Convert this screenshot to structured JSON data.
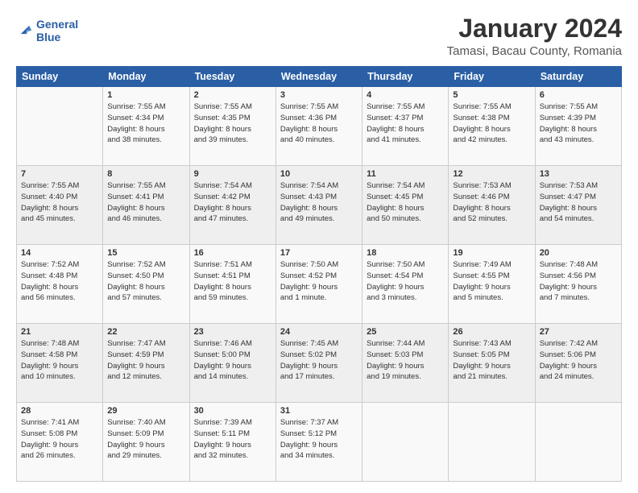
{
  "logo": {
    "line1": "General",
    "line2": "Blue"
  },
  "title": "January 2024",
  "subtitle": "Tamasi, Bacau County, Romania",
  "weekdays": [
    "Sunday",
    "Monday",
    "Tuesday",
    "Wednesday",
    "Thursday",
    "Friday",
    "Saturday"
  ],
  "weeks": [
    [
      {
        "day": "",
        "sunrise": "",
        "sunset": "",
        "daylight": ""
      },
      {
        "day": "1",
        "sunrise": "Sunrise: 7:55 AM",
        "sunset": "Sunset: 4:34 PM",
        "daylight": "Daylight: 8 hours and 38 minutes."
      },
      {
        "day": "2",
        "sunrise": "Sunrise: 7:55 AM",
        "sunset": "Sunset: 4:35 PM",
        "daylight": "Daylight: 8 hours and 39 minutes."
      },
      {
        "day": "3",
        "sunrise": "Sunrise: 7:55 AM",
        "sunset": "Sunset: 4:36 PM",
        "daylight": "Daylight: 8 hours and 40 minutes."
      },
      {
        "day": "4",
        "sunrise": "Sunrise: 7:55 AM",
        "sunset": "Sunset: 4:37 PM",
        "daylight": "Daylight: 8 hours and 41 minutes."
      },
      {
        "day": "5",
        "sunrise": "Sunrise: 7:55 AM",
        "sunset": "Sunset: 4:38 PM",
        "daylight": "Daylight: 8 hours and 42 minutes."
      },
      {
        "day": "6",
        "sunrise": "Sunrise: 7:55 AM",
        "sunset": "Sunset: 4:39 PM",
        "daylight": "Daylight: 8 hours and 43 minutes."
      }
    ],
    [
      {
        "day": "7",
        "sunrise": "Sunrise: 7:55 AM",
        "sunset": "Sunset: 4:40 PM",
        "daylight": "Daylight: 8 hours and 45 minutes."
      },
      {
        "day": "8",
        "sunrise": "Sunrise: 7:55 AM",
        "sunset": "Sunset: 4:41 PM",
        "daylight": "Daylight: 8 hours and 46 minutes."
      },
      {
        "day": "9",
        "sunrise": "Sunrise: 7:54 AM",
        "sunset": "Sunset: 4:42 PM",
        "daylight": "Daylight: 8 hours and 47 minutes."
      },
      {
        "day": "10",
        "sunrise": "Sunrise: 7:54 AM",
        "sunset": "Sunset: 4:43 PM",
        "daylight": "Daylight: 8 hours and 49 minutes."
      },
      {
        "day": "11",
        "sunrise": "Sunrise: 7:54 AM",
        "sunset": "Sunset: 4:45 PM",
        "daylight": "Daylight: 8 hours and 50 minutes."
      },
      {
        "day": "12",
        "sunrise": "Sunrise: 7:53 AM",
        "sunset": "Sunset: 4:46 PM",
        "daylight": "Daylight: 8 hours and 52 minutes."
      },
      {
        "day": "13",
        "sunrise": "Sunrise: 7:53 AM",
        "sunset": "Sunset: 4:47 PM",
        "daylight": "Daylight: 8 hours and 54 minutes."
      }
    ],
    [
      {
        "day": "14",
        "sunrise": "Sunrise: 7:52 AM",
        "sunset": "Sunset: 4:48 PM",
        "daylight": "Daylight: 8 hours and 56 minutes."
      },
      {
        "day": "15",
        "sunrise": "Sunrise: 7:52 AM",
        "sunset": "Sunset: 4:50 PM",
        "daylight": "Daylight: 8 hours and 57 minutes."
      },
      {
        "day": "16",
        "sunrise": "Sunrise: 7:51 AM",
        "sunset": "Sunset: 4:51 PM",
        "daylight": "Daylight: 8 hours and 59 minutes."
      },
      {
        "day": "17",
        "sunrise": "Sunrise: 7:50 AM",
        "sunset": "Sunset: 4:52 PM",
        "daylight": "Daylight: 9 hours and 1 minute."
      },
      {
        "day": "18",
        "sunrise": "Sunrise: 7:50 AM",
        "sunset": "Sunset: 4:54 PM",
        "daylight": "Daylight: 9 hours and 3 minutes."
      },
      {
        "day": "19",
        "sunrise": "Sunrise: 7:49 AM",
        "sunset": "Sunset: 4:55 PM",
        "daylight": "Daylight: 9 hours and 5 minutes."
      },
      {
        "day": "20",
        "sunrise": "Sunrise: 7:48 AM",
        "sunset": "Sunset: 4:56 PM",
        "daylight": "Daylight: 9 hours and 7 minutes."
      }
    ],
    [
      {
        "day": "21",
        "sunrise": "Sunrise: 7:48 AM",
        "sunset": "Sunset: 4:58 PM",
        "daylight": "Daylight: 9 hours and 10 minutes."
      },
      {
        "day": "22",
        "sunrise": "Sunrise: 7:47 AM",
        "sunset": "Sunset: 4:59 PM",
        "daylight": "Daylight: 9 hours and 12 minutes."
      },
      {
        "day": "23",
        "sunrise": "Sunrise: 7:46 AM",
        "sunset": "Sunset: 5:00 PM",
        "daylight": "Daylight: 9 hours and 14 minutes."
      },
      {
        "day": "24",
        "sunrise": "Sunrise: 7:45 AM",
        "sunset": "Sunset: 5:02 PM",
        "daylight": "Daylight: 9 hours and 17 minutes."
      },
      {
        "day": "25",
        "sunrise": "Sunrise: 7:44 AM",
        "sunset": "Sunset: 5:03 PM",
        "daylight": "Daylight: 9 hours and 19 minutes."
      },
      {
        "day": "26",
        "sunrise": "Sunrise: 7:43 AM",
        "sunset": "Sunset: 5:05 PM",
        "daylight": "Daylight: 9 hours and 21 minutes."
      },
      {
        "day": "27",
        "sunrise": "Sunrise: 7:42 AM",
        "sunset": "Sunset: 5:06 PM",
        "daylight": "Daylight: 9 hours and 24 minutes."
      }
    ],
    [
      {
        "day": "28",
        "sunrise": "Sunrise: 7:41 AM",
        "sunset": "Sunset: 5:08 PM",
        "daylight": "Daylight: 9 hours and 26 minutes."
      },
      {
        "day": "29",
        "sunrise": "Sunrise: 7:40 AM",
        "sunset": "Sunset: 5:09 PM",
        "daylight": "Daylight: 9 hours and 29 minutes."
      },
      {
        "day": "30",
        "sunrise": "Sunrise: 7:39 AM",
        "sunset": "Sunset: 5:11 PM",
        "daylight": "Daylight: 9 hours and 32 minutes."
      },
      {
        "day": "31",
        "sunrise": "Sunrise: 7:37 AM",
        "sunset": "Sunset: 5:12 PM",
        "daylight": "Daylight: 9 hours and 34 minutes."
      },
      {
        "day": "",
        "sunrise": "",
        "sunset": "",
        "daylight": ""
      },
      {
        "day": "",
        "sunrise": "",
        "sunset": "",
        "daylight": ""
      },
      {
        "day": "",
        "sunrise": "",
        "sunset": "",
        "daylight": ""
      }
    ]
  ]
}
